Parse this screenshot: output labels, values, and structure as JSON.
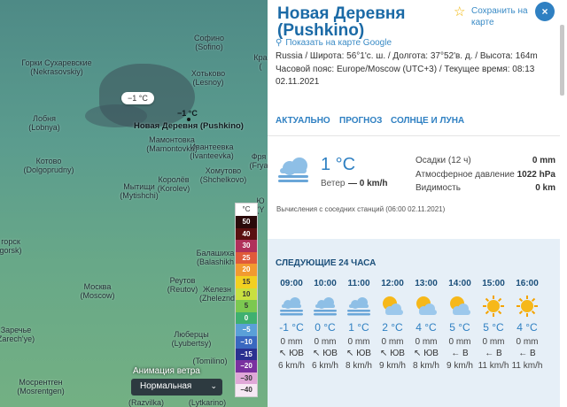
{
  "map": {
    "temp_bubble": "−1 °C",
    "temp_point": "−1 °C",
    "cities": [
      {
        "key": "sofino",
        "name": "Софино",
        "alt": "(Sofino)"
      },
      {
        "key": "gorki",
        "name": "Горки Сухаревские",
        "alt": "(Nekrasovskiy)"
      },
      {
        "key": "lesnoy",
        "name": "Хотьково",
        "alt": "(Lesnoy)"
      },
      {
        "key": "lobnya",
        "name": "Лобня",
        "alt": "(Lobnya)"
      },
      {
        "key": "pushkino",
        "name": "Новая Деревня (Pushkino)",
        "alt": ""
      },
      {
        "key": "mamontovka",
        "name": "Мамонтовка",
        "alt": "(Mamontovka)"
      },
      {
        "key": "ivanteevka",
        "name": "Ивантеевка",
        "alt": "(Ivanteevka)"
      },
      {
        "key": "kotovo",
        "name": "Котово",
        "alt": "(Dolgoprudny)"
      },
      {
        "key": "shchelkovo",
        "name": "Хомутово",
        "alt": "(Shchelkovo)"
      },
      {
        "key": "korolev",
        "name": "Королёв",
        "alt": "(Korolev)"
      },
      {
        "key": "mytishchi",
        "name": "Мытищи",
        "alt": "(Mytishchi)"
      },
      {
        "key": "gorsk",
        "name": "горск",
        "alt": "gorsk)"
      },
      {
        "key": "balashikha",
        "name": "Балашиха",
        "alt": "(Balashikh"
      },
      {
        "key": "moscow",
        "name": "Москва",
        "alt": "(Moscow)"
      },
      {
        "key": "reutov",
        "name": "Реутов",
        "alt": "(Reutov)"
      },
      {
        "key": "zhelez",
        "name": "Железн",
        "alt": "(Zheleznd"
      },
      {
        "key": "lyubertsy",
        "name": "Люберцы",
        "alt": "(Lyubertsy)"
      },
      {
        "key": "zarechye",
        "name": "Заречье",
        "alt": "Zarech'ye)"
      },
      {
        "key": "mosrentgen",
        "name": "Мосрентген",
        "alt": "(Mosrentgen)"
      },
      {
        "key": "razvilka",
        "name": "(Razvilka)",
        "alt": ""
      },
      {
        "key": "tomilino",
        "name": "(Tomilino)",
        "alt": ""
      },
      {
        "key": "lytkarino",
        "name": "(Lytkarino)",
        "alt": ""
      },
      {
        "key": "pravda",
        "name": "Кра",
        "alt": "("
      },
      {
        "key": "fryazino",
        "name": "Фря",
        "alt": "(Frya"
      },
      {
        "key": "yu",
        "name": "Ю",
        "alt": "(Y"
      }
    ],
    "legend": {
      "unit": "°C",
      "steps": [
        {
          "label": "50",
          "color": "#2a0a0a",
          "text": "#ffffff"
        },
        {
          "label": "40",
          "color": "#5a1010",
          "text": "#ffffff"
        },
        {
          "label": "30",
          "color": "#b0305a",
          "text": "#ffffff"
        },
        {
          "label": "25",
          "color": "#e05a3a",
          "text": "#ffffff"
        },
        {
          "label": "20",
          "color": "#f29a30",
          "text": "#ffffff"
        },
        {
          "label": "15",
          "color": "#f2d020",
          "text": "#333333"
        },
        {
          "label": "10",
          "color": "#c8e040",
          "text": "#333333"
        },
        {
          "label": "5",
          "color": "#7cc850",
          "text": "#333333"
        },
        {
          "label": "0",
          "color": "#3fb070",
          "text": "#ffffff"
        },
        {
          "label": "−5",
          "color": "#5aa0d8",
          "text": "#ffffff"
        },
        {
          "label": "−10",
          "color": "#3a68c0",
          "text": "#ffffff"
        },
        {
          "label": "−15",
          "color": "#2a3090",
          "text": "#ffffff"
        },
        {
          "label": "−20",
          "color": "#7a30a0",
          "text": "#ffffff"
        },
        {
          "label": "−30",
          "color": "#e0a8d8",
          "text": "#333333"
        },
        {
          "label": "−40",
          "color": "#f6e8f4",
          "text": "#333333"
        }
      ]
    },
    "animation_label": "Анимация ветра",
    "animation_value": "Нормальная"
  },
  "panel": {
    "title": "Новая Деревня (Pushkino)",
    "save_label": "Сохранить на карте",
    "close_label": "×",
    "show_on_map": "Показать на карте Google",
    "coords_line1": "Russia / Широта: 56°1'с. ш. / Долгота: 37°52'в. д. / Высота: 164m",
    "coords_line2": "Часовой пояс: Europe/Moscow (UTC+3) / Текущее время: 08:13",
    "coords_line3": "02.11.2021",
    "tabs": [
      "АКТУАЛЬНО",
      "ПРОГНОЗ",
      "СОЛНЦЕ И ЛУНА"
    ],
    "current": {
      "temp": "1 °C",
      "wind_label": "Ветер",
      "wind_value": "— 0 km/h",
      "stats": [
        {
          "label": "Осадки (12 ч)",
          "value": "0 mm"
        },
        {
          "label": "Атмосферное давление",
          "value": "1022 hPa"
        },
        {
          "label": "Видимость",
          "value": "0 km"
        }
      ],
      "note": "Вычисления с соседних станций (06:00 02.11.2021)"
    },
    "forecast_title": "СЛЕДУЮЩИЕ 24 ЧАСА",
    "forecast": [
      {
        "time": "09:00",
        "icon": "fog-icon",
        "temp": "-1 °C",
        "precip": "0 mm",
        "dir": "↖ ЮВ",
        "speed": "6 km/h"
      },
      {
        "time": "10:00",
        "icon": "fog-icon",
        "temp": "0 °C",
        "precip": "0 mm",
        "dir": "↖ ЮВ",
        "speed": "6 km/h"
      },
      {
        "time": "11:00",
        "icon": "fog-icon",
        "temp": "1 °C",
        "precip": "0 mm",
        "dir": "↖ ЮВ",
        "speed": "8 km/h"
      },
      {
        "time": "12:00",
        "icon": "partly-sunny-icon",
        "temp": "2 °C",
        "precip": "0 mm",
        "dir": "↖ ЮВ",
        "speed": "9 km/h"
      },
      {
        "time": "13:00",
        "icon": "partly-sunny-icon",
        "temp": "4 °C",
        "precip": "0 mm",
        "dir": "↖ ЮВ",
        "speed": "8 km/h"
      },
      {
        "time": "14:00",
        "icon": "partly-sunny-icon",
        "temp": "5 °C",
        "precip": "0 mm",
        "dir": "← В",
        "speed": "9 km/h"
      },
      {
        "time": "15:00",
        "icon": "sun-icon",
        "temp": "5 °C",
        "precip": "0 mm",
        "dir": "← В",
        "speed": "11 km/h"
      },
      {
        "time": "16:00",
        "icon": "sun-icon",
        "temp": "4 °C",
        "precip": "0 mm",
        "dir": "← В",
        "speed": "11 km/h"
      }
    ]
  }
}
